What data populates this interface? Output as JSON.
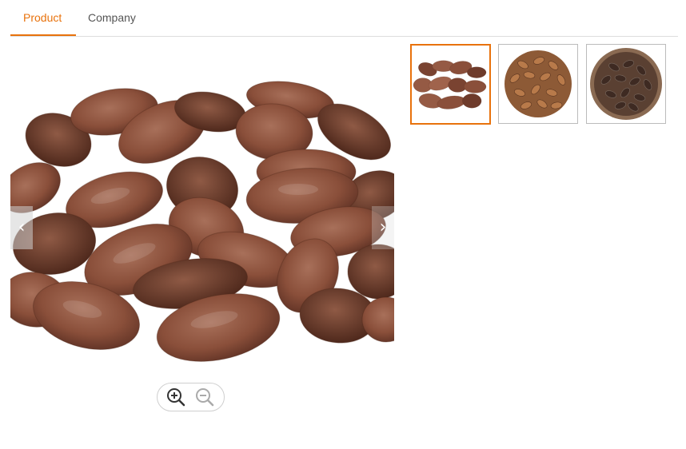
{
  "tabs": [
    {
      "label": "Product",
      "active": true
    },
    {
      "label": "Company",
      "active": false
    }
  ],
  "gallery": {
    "thumbnail_count": 3,
    "selected_thumbnail": 1
  },
  "colors": {
    "accent": "#e8720c",
    "border": "#dddddd"
  },
  "icons": {
    "prev": "chevron-left-icon",
    "next": "chevron-right-icon",
    "zoom_in": "zoom-in-icon",
    "zoom_out": "zoom-out-icon"
  }
}
